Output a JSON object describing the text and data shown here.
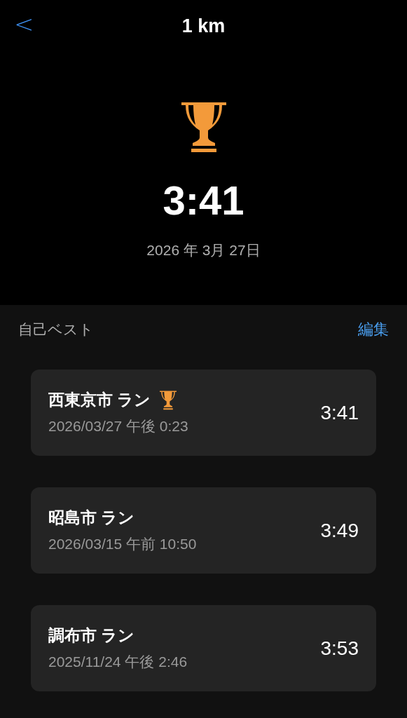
{
  "nav": {
    "back": "<",
    "title": "1 km"
  },
  "hero": {
    "time": "3:41",
    "date": "2026 年 3月 27日"
  },
  "section": {
    "title": "自己ベスト",
    "edit": "編集"
  },
  "records": [
    {
      "name": "西東京市 ラン",
      "best": true,
      "datetime": "2026/03/27 午後 0:23",
      "time": "3:41"
    },
    {
      "name": "昭島市 ラン",
      "best": false,
      "datetime": "2026/03/15 午前 10:50",
      "time": "3:49"
    },
    {
      "name": "調布市 ラン",
      "best": false,
      "datetime": "2025/11/24 午後 2:46",
      "time": "3:53"
    }
  ]
}
